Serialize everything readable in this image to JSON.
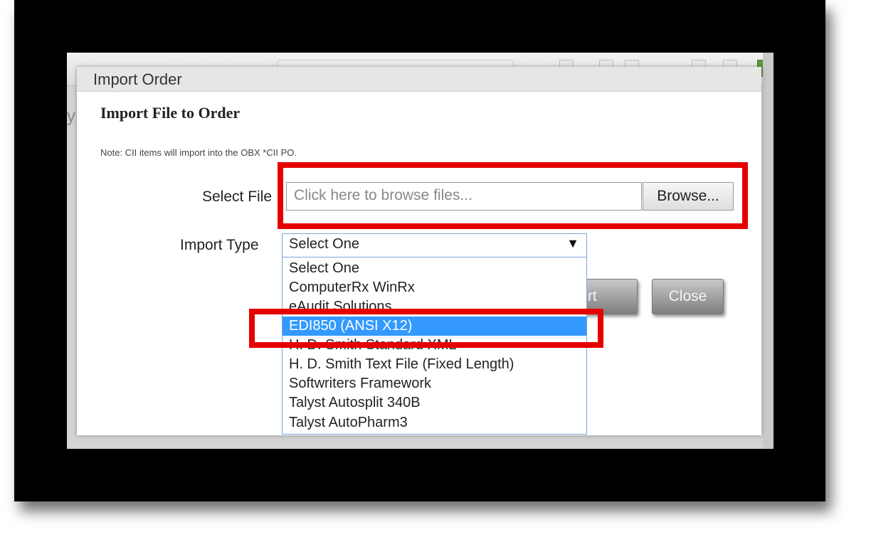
{
  "dialog": {
    "title": "Import Order",
    "heading": "Import File to Order",
    "note": "Note: CII items will import into the OBX *CII PO.",
    "select_file_label": "Select File",
    "file_placeholder": "Click here to browse files...",
    "browse_label": "Browse...",
    "import_type_label": "Import Type",
    "import_type_selected": "Select One",
    "import_button_label": "Import",
    "close_button_label": "Close"
  },
  "dropdown": {
    "options": [
      "Select One",
      "ComputerRx WinRx",
      "eAudit Solutions",
      "EDI850 (ANSI X12)",
      "H. D. Smith Standard XML",
      "H. D. Smith Text File (Fixed Length)",
      "Softwriters Framework",
      "Talyst Autosplit 340B",
      "Talyst AutoPharm3"
    ],
    "highlighted_option": "EDI850 (ANSI X12)"
  },
  "background": {
    "partial_letter": "y"
  },
  "icons": {
    "dropdown_arrow": "▼"
  },
  "colors": {
    "highlight_red": "#e60000",
    "selected_blue": "#3399ff"
  }
}
